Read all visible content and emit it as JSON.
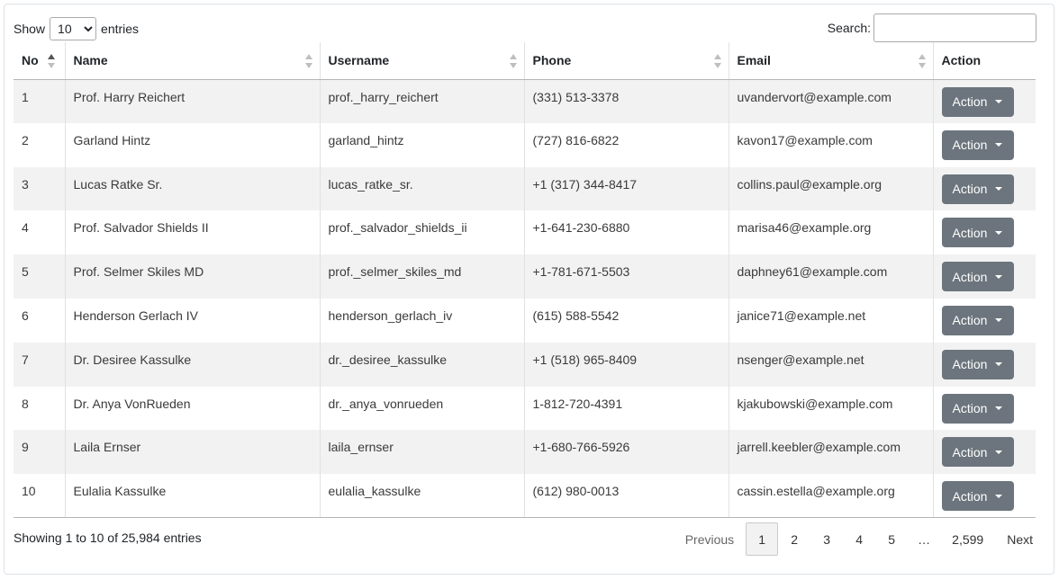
{
  "controls": {
    "show_label": "Show",
    "entries_label": "entries",
    "page_size": "10",
    "search_label": "Search:",
    "search_value": ""
  },
  "table": {
    "headers": [
      "No",
      "Name",
      "Username",
      "Phone",
      "Email",
      "Action"
    ],
    "rows": [
      {
        "no": "1",
        "name": "Prof. Harry Reichert",
        "username": "prof._harry_reichert",
        "phone": "(331) 513-3378",
        "email": "uvandervort@example.com",
        "action": "Action"
      },
      {
        "no": "2",
        "name": "Garland Hintz",
        "username": "garland_hintz",
        "phone": "(727) 816-6822",
        "email": "kavon17@example.com",
        "action": "Action"
      },
      {
        "no": "3",
        "name": "Lucas Ratke Sr.",
        "username": "lucas_ratke_sr.",
        "phone": "+1 (317) 344-8417",
        "email": "collins.paul@example.org",
        "action": "Action"
      },
      {
        "no": "4",
        "name": "Prof. Salvador Shields II",
        "username": "prof._salvador_shields_ii",
        "phone": "+1-641-230-6880",
        "email": "marisa46@example.org",
        "action": "Action"
      },
      {
        "no": "5",
        "name": "Prof. Selmer Skiles MD",
        "username": "prof._selmer_skiles_md",
        "phone": "+1-781-671-5503",
        "email": "daphney61@example.com",
        "action": "Action"
      },
      {
        "no": "6",
        "name": "Henderson Gerlach IV",
        "username": "henderson_gerlach_iv",
        "phone": "(615) 588-5542",
        "email": "janice71@example.net",
        "action": "Action"
      },
      {
        "no": "7",
        "name": "Dr. Desiree Kassulke",
        "username": "dr._desiree_kassulke",
        "phone": "+1 (518) 965-8409",
        "email": "nsenger@example.net",
        "action": "Action"
      },
      {
        "no": "8",
        "name": "Dr. Anya VonRueden",
        "username": "dr._anya_vonrueden",
        "phone": "1-812-720-4391",
        "email": "kjakubowski@example.com",
        "action": "Action"
      },
      {
        "no": "9",
        "name": "Laila Ernser",
        "username": "laila_ernser",
        "phone": "+1-680-766-5926",
        "email": "jarrell.keebler@example.com",
        "action": "Action"
      },
      {
        "no": "10",
        "name": "Eulalia Kassulke",
        "username": "eulalia_kassulke",
        "phone": "(612) 980-0013",
        "email": "cassin.estella@example.org",
        "action": "Action"
      }
    ]
  },
  "footer": {
    "info": "Showing 1 to 10 of 25,984 entries"
  },
  "pagination": {
    "previous": "Previous",
    "pages": [
      "1",
      "2",
      "3",
      "4",
      "5",
      "…",
      "2,599"
    ],
    "current": "1",
    "next": "Next"
  },
  "colors": {
    "action_button": "#6c757d",
    "stripe": "#f2f2f2"
  }
}
